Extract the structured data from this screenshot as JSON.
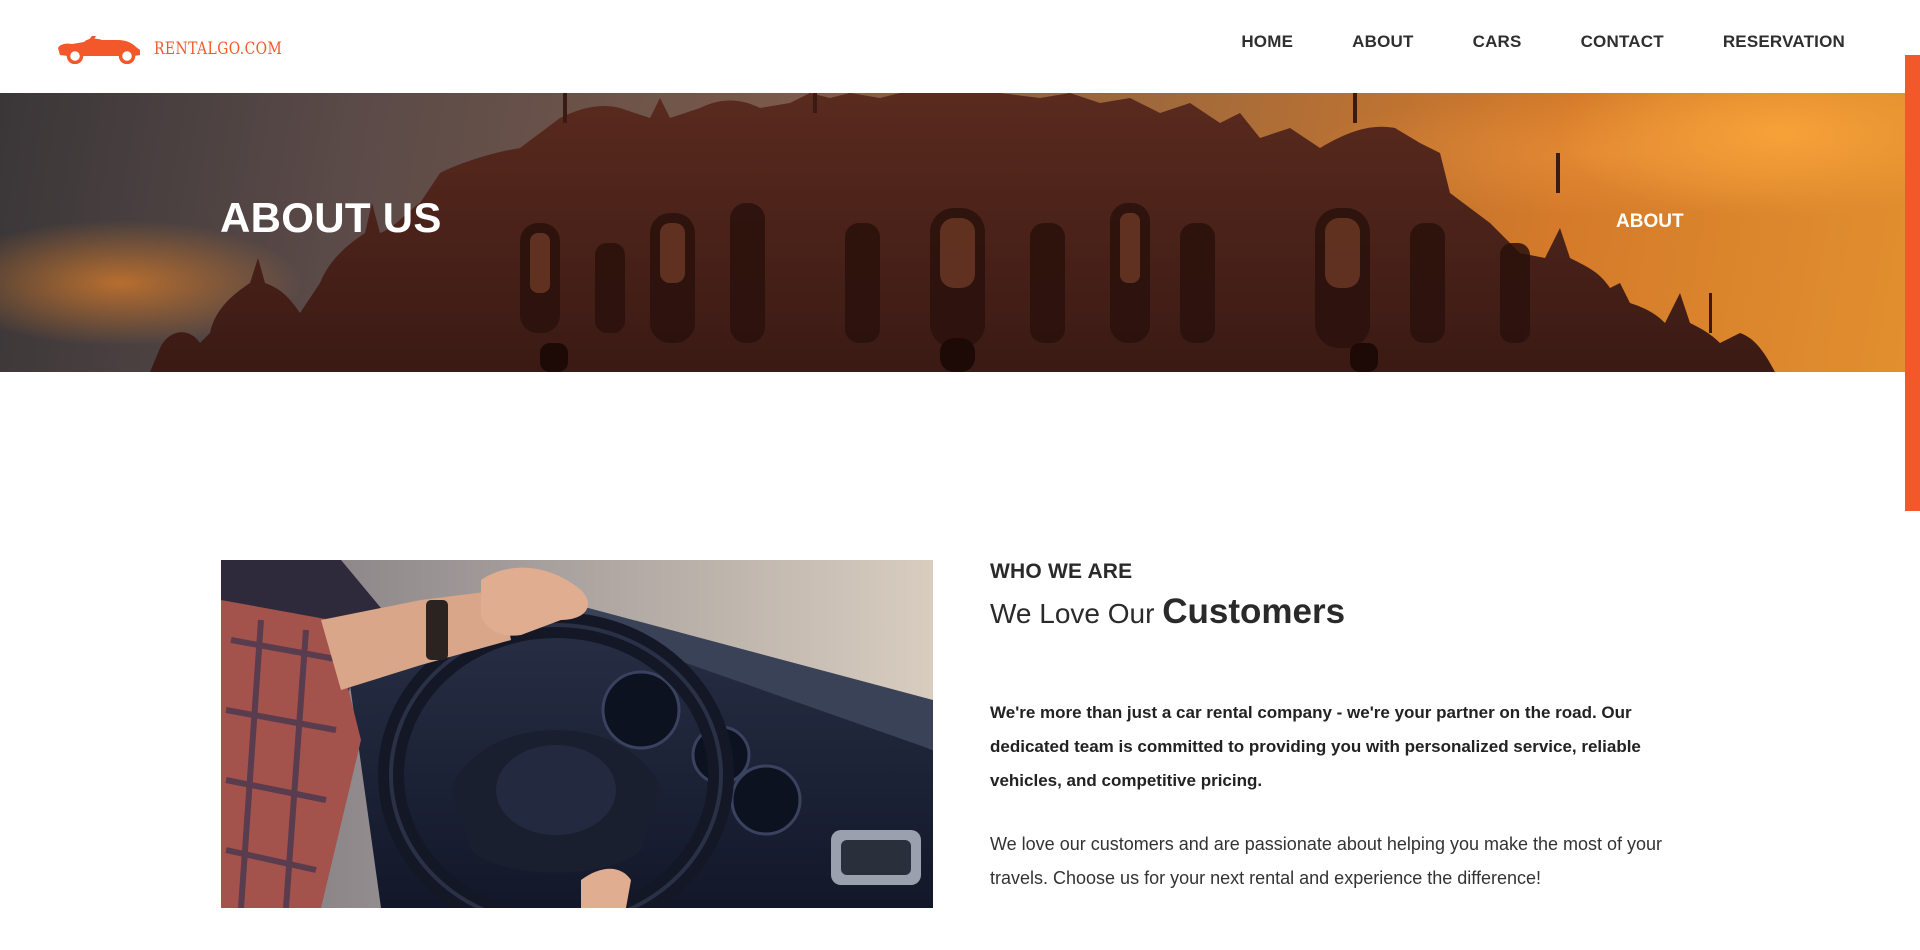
{
  "brand": {
    "logo_text": "RENTALGO.COM",
    "accent_color": "#f2582a"
  },
  "nav": {
    "items": [
      {
        "label": "HOME"
      },
      {
        "label": "ABOUT"
      },
      {
        "label": "CARS"
      },
      {
        "label": "CONTACT"
      },
      {
        "label": "RESERVATION"
      }
    ]
  },
  "hero": {
    "title": "ABOUT US",
    "breadcrumb": "ABOUT"
  },
  "about": {
    "eyebrow": "WHO WE ARE",
    "heading_plain": "We Love Our ",
    "heading_strong": "Customers",
    "lead": "We're more than just a car rental company - we're your partner on the road. Our dedicated team is committed to providing you with personalized service, reliable vehicles, and competitive pricing.",
    "body": "We love our customers and are passionate about helping you make the most of your travels. Choose us for your next rental and experience the difference!"
  },
  "icons": {
    "logo": "car-icon"
  }
}
